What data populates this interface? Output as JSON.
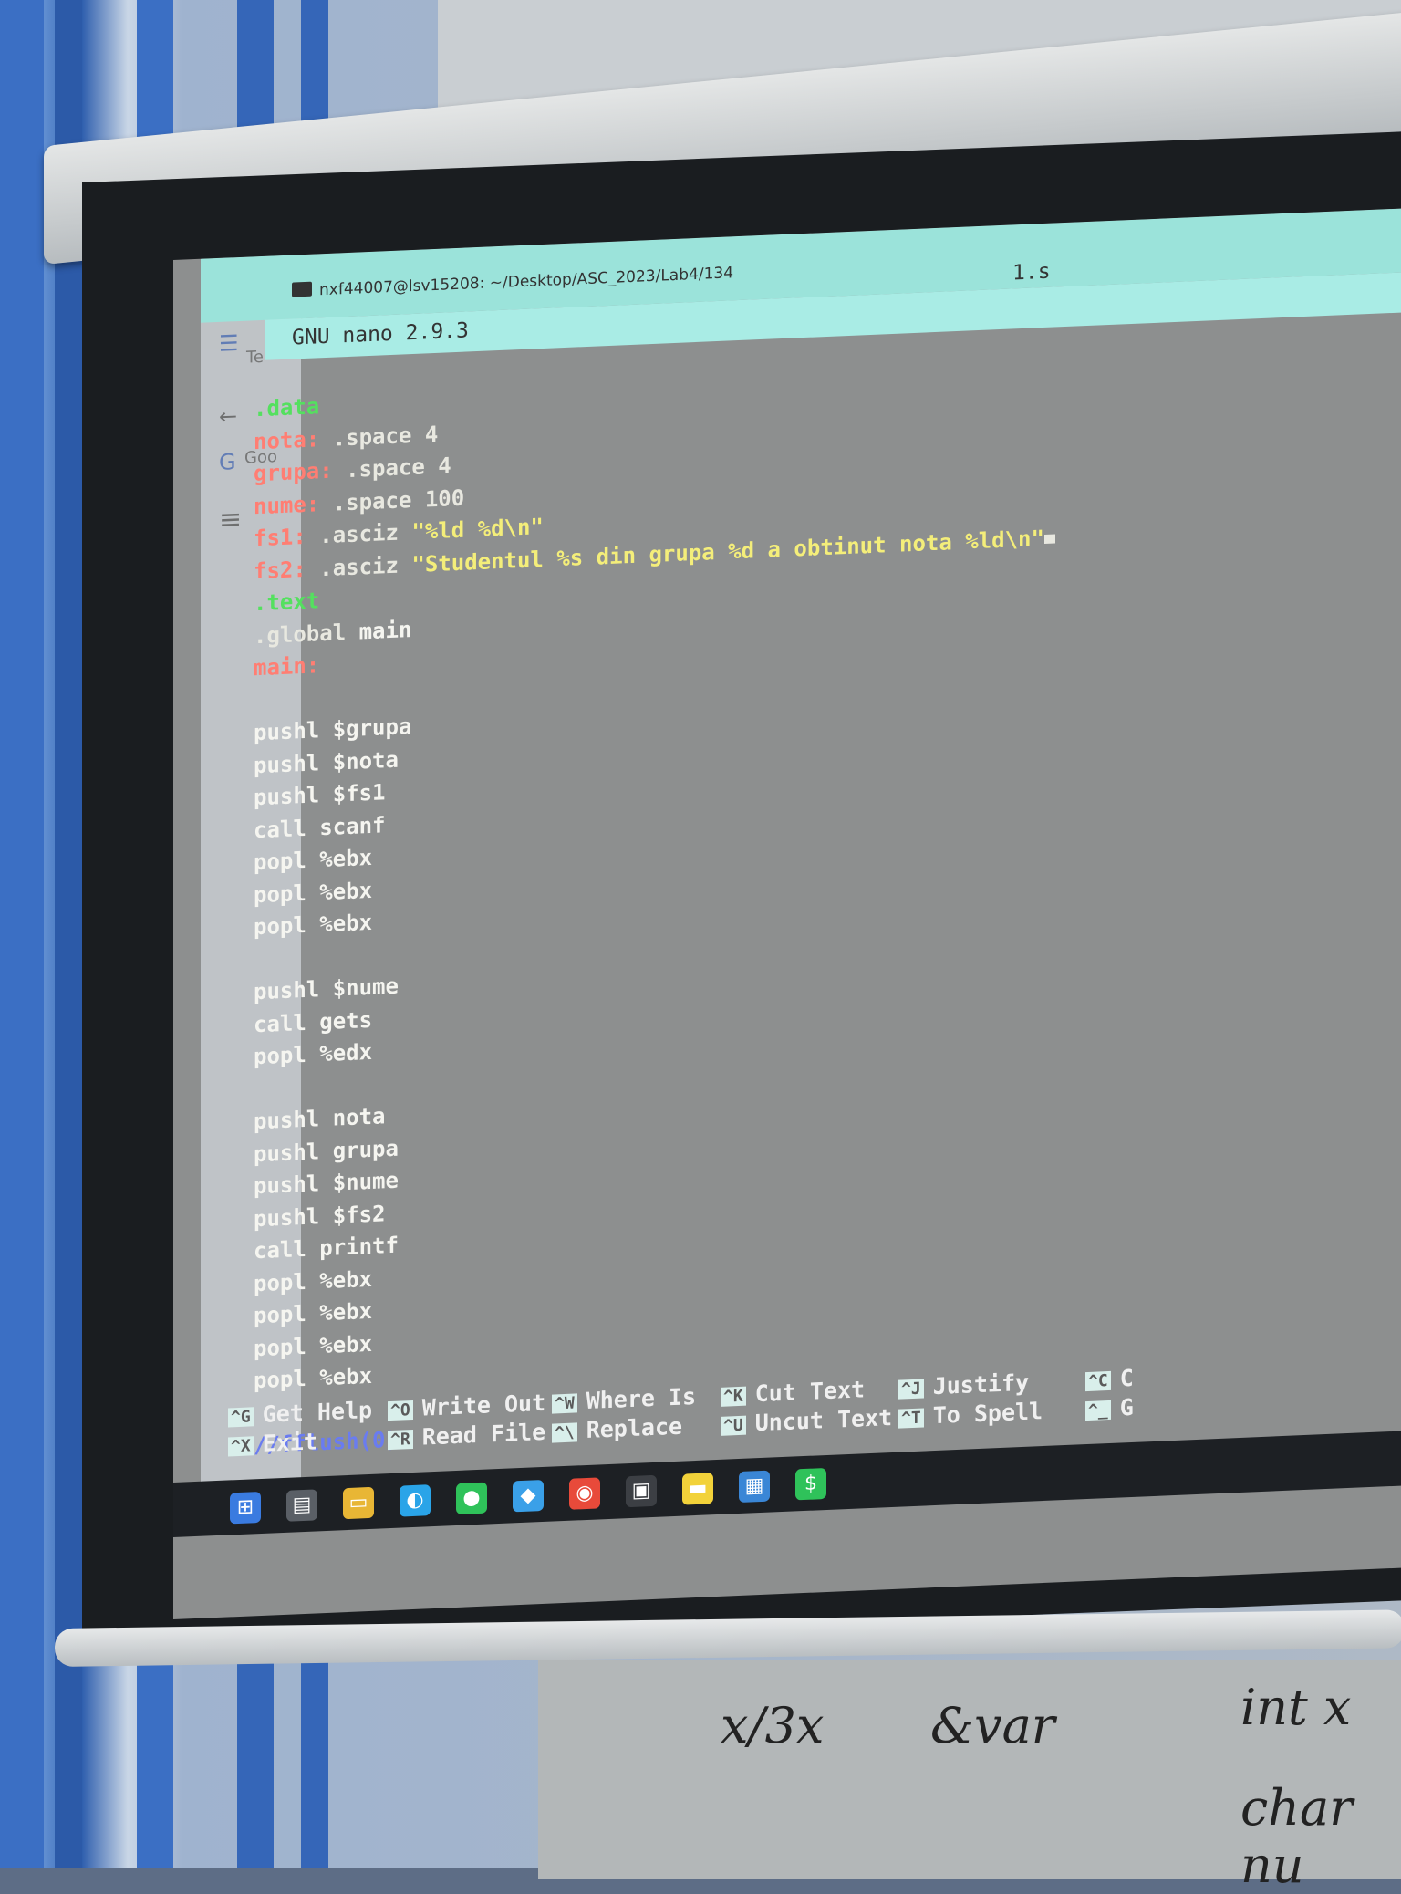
{
  "window": {
    "title": "nxf44007@lsv15208: ~/Desktop/ASC_2023/Lab4/134",
    "nano_version": "GNU nano 2.9.3",
    "file_name": "1.s"
  },
  "browser": {
    "tab_partial": "Te",
    "google_partial": "Goo"
  },
  "code": {
    "l1": ".data",
    "l2_label": "nota:",
    "l2_rest": " .space 4",
    "l3_label": "grupa:",
    "l3_rest": " .space 4",
    "l4_label": "nume:",
    "l4_rest": " .space 100",
    "l5_label": "fs1:",
    "l5_dir": " .asciz ",
    "l5_str": "\"%ld %d\\n\"",
    "l6_label": "fs2:",
    "l6_dir": " .asciz ",
    "l6_str": "\"Studentul %s din grupa %d a obtinut nota %ld\\n\"",
    "l7": ".text",
    "l8_dir": ".global",
    "l8_rest": " main",
    "l9": "main:",
    "b1": [
      "pushl $grupa",
      "pushl $nota",
      "pushl $fs1",
      "call scanf",
      "popl %ebx",
      "popl %ebx",
      "popl %ebx"
    ],
    "b2": [
      "pushl $nume",
      "call gets",
      "popl %edx"
    ],
    "b3": [
      "pushl nota",
      "pushl grupa",
      "pushl $nume",
      "pushl $fs2",
      "call printf",
      "popl %ebx",
      "popl %ebx",
      "popl %ebx",
      "popl %ebx"
    ],
    "comment": "//fflush(0)"
  },
  "shortcuts": [
    {
      "key": "^G",
      "label": "Get Help"
    },
    {
      "key": "^X",
      "label": "Exit"
    },
    {
      "key": "^O",
      "label": "Write Out"
    },
    {
      "key": "^R",
      "label": "Read File"
    },
    {
      "key": "^W",
      "label": "Where Is"
    },
    {
      "key": "^\\",
      "label": "Replace"
    },
    {
      "key": "^K",
      "label": "Cut Text"
    },
    {
      "key": "^U",
      "label": "Uncut Text"
    },
    {
      "key": "^J",
      "label": "Justify"
    },
    {
      "key": "^T",
      "label": "To Spell"
    },
    {
      "key": "^C",
      "label": "C"
    },
    {
      "key": "^_",
      "label": "G"
    }
  ],
  "whiteboard": {
    "w1": "x/3x",
    "w2": "&var",
    "w3": "int x",
    "w4": "char nu"
  },
  "colors": {
    "section": "#54e05f",
    "label": "#ff7e73",
    "string": "#f4ee7a",
    "comment": "#6a7cf0",
    "header_bg": "#a9ece5"
  },
  "taskbar_icons": [
    "windows-icon",
    "task-view-icon",
    "file-explorer-icon",
    "edge-icon",
    "spotify-icon",
    "vscode-icon",
    "chrome-icon",
    "terminal-icon",
    "sticky-notes-icon",
    "calculator-icon",
    "dollar-icon"
  ]
}
